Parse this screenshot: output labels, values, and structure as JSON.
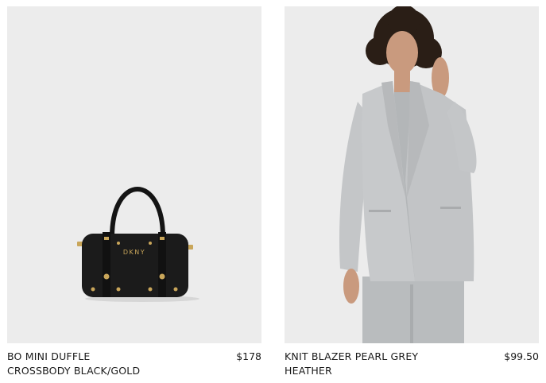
{
  "products": [
    {
      "name_line1": "BO MINI DUFFLE",
      "name_line2": "CROSSBODY BLACK/GOLD",
      "price": "$178",
      "image_desc": "black-duffle-bag",
      "brand_mark": "DKNY"
    },
    {
      "name_line1": "KNIT BLAZER PEARL GREY",
      "name_line2": "HEATHER",
      "price": "$99.50",
      "image_desc": "grey-knit-blazer-model"
    }
  ],
  "colors": {
    "image_bg": "#ececec",
    "text": "#1a1a1a",
    "bag_black": "#1b1b1b",
    "gold": "#c9a65a",
    "blazer_grey": "#c4c6c8"
  }
}
